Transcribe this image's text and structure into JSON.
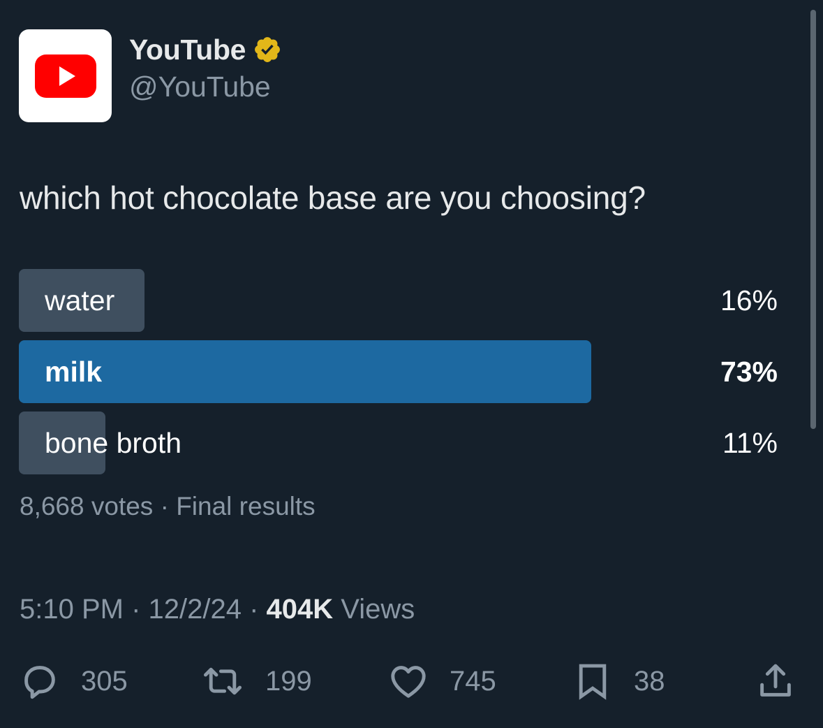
{
  "author": {
    "display_name": "YouTube",
    "handle": "@YouTube",
    "avatar_icon": "youtube-logo",
    "verified_icon": "gold-verified-badge",
    "brand_color": "#ff0000",
    "verified_color": "#e2b719"
  },
  "tweet": {
    "text": "which hot chocolate base are you choosing?"
  },
  "poll": {
    "options": [
      {
        "label": "water",
        "percent_text": "16%",
        "value": 16,
        "winner": false
      },
      {
        "label": "milk",
        "percent_text": "73%",
        "value": 73,
        "winner": true
      },
      {
        "label": "bone broth",
        "percent_text": "11%",
        "value": 11,
        "winner": false
      }
    ],
    "votes": "8,668 votes",
    "separator": " · ",
    "status": "Final results",
    "winner_color": "#1d69a1",
    "loser_color": "#3f4f5f"
  },
  "meta": {
    "time": "5:10 PM",
    "date": "12/2/24",
    "separator": " · ",
    "views_count": "404K",
    "views_label": " Views"
  },
  "actions": {
    "reply": {
      "icon": "reply-icon",
      "count": "305"
    },
    "retweet": {
      "icon": "retweet-icon",
      "count": "199"
    },
    "like": {
      "icon": "heart-icon",
      "count": "745"
    },
    "bookmark": {
      "icon": "bookmark-icon",
      "count": "38"
    },
    "share": {
      "icon": "share-icon"
    }
  }
}
